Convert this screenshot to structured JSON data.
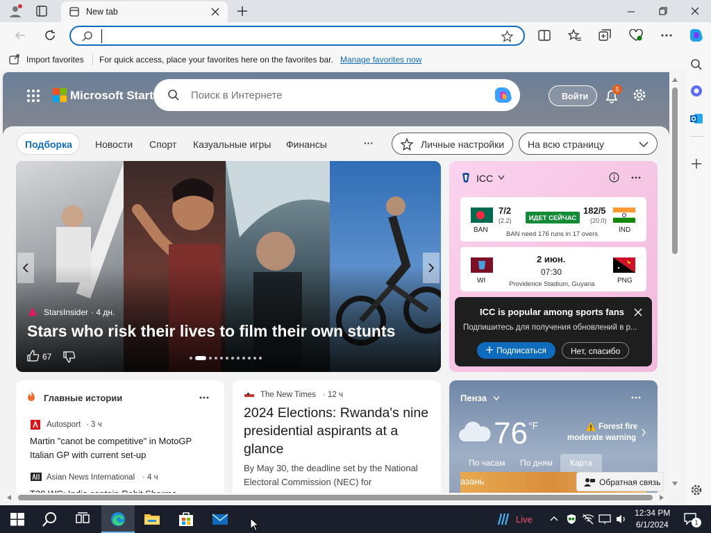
{
  "browser": {
    "tab_title": "New tab",
    "address_value": "",
    "favorites_bar": {
      "import_label": "Import favorites",
      "message": "For quick access, place your favorites here on the favorites bar.",
      "manage_link": "Manage favorites now"
    }
  },
  "header": {
    "brand": "Microsoft Start",
    "search_placeholder": "Поиск в Интернете",
    "signin_label": "Войти",
    "notification_count": "5"
  },
  "nav": {
    "tabs": [
      "Подборка",
      "Новости",
      "Спорт",
      "Казуальные игры",
      "Финансы"
    ],
    "active_tab": "Подборка",
    "more": "···",
    "personalize_label": "Личные настройки",
    "layout_label": "На всю страницу"
  },
  "hero": {
    "source": "StarsInsider",
    "time": "· 4 дн.",
    "headline": "Stars who risk their lives to film their own stunts",
    "likes": "67",
    "slide_count": 12,
    "active_slide": 2
  },
  "icc": {
    "title": "ICC",
    "match1": {
      "team1_code": "BAN",
      "team1_score": "7/2",
      "team1_overs": "(2.2)",
      "status": "ИДЕТ СЕЙЧАС",
      "team2_code": "IND",
      "team2_score": "182/5",
      "team2_overs": "(20.0)",
      "note": "BAN need 176 runs in 17 overs"
    },
    "match2": {
      "team1_code": "WI",
      "date": "2 июн.",
      "time": "07:30",
      "venue": "Providence Stadium, Guyana",
      "team2_code": "PNG"
    },
    "popup": {
      "title": "ICC is popular among sports fans",
      "text": "Подпишитесь для получения обновлений в р...",
      "subscribe": "Подписаться",
      "decline": "Нет, спасибо"
    }
  },
  "top_stories": {
    "title": "Главные истории",
    "items": [
      {
        "source": "Autosport",
        "time": "· 3 ч",
        "headline": "Martin \"canot be competitive\" in MotoGP Italian GP with current set-up"
      },
      {
        "source": "Asian News International",
        "time": "· 4 ч",
        "headline": "T20 WC: India captain Rohit Sharma"
      }
    ]
  },
  "article": {
    "source": "The New Times",
    "time": "· 12 ч",
    "headline": "2024 Elections: Rwanda's nine presidential aspirants at a glance",
    "snippet": "By May 30, the deadline set by the National Electoral Commission (NEC) for"
  },
  "weather": {
    "location": "Пенза",
    "temp": "76",
    "unit": "°F",
    "alert_title": "Forest fire",
    "alert_sub": "moderate warning",
    "tabs": [
      "По часам",
      "По дням",
      "Карта"
    ],
    "active_tab": "Карта",
    "map_label": "азань",
    "feedback": "Обратная связь"
  },
  "taskbar": {
    "live_label": "Live",
    "time": "12:34 PM",
    "date": "6/1/2024",
    "notif_count": "1"
  },
  "colors": {
    "accent": "#0f6cbd",
    "live_badge": "#138a36",
    "taskbar": "#1b1f2c",
    "icc_bg": "#f7c9e6",
    "popup_bg": "#1e1e1e"
  }
}
